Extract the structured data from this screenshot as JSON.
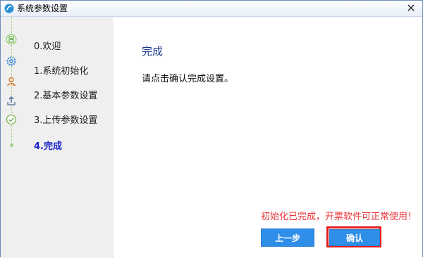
{
  "window": {
    "title": "系统参数设置",
    "close_glyph": "✕"
  },
  "steps": [
    {
      "label": "0.欢迎",
      "icon": "document-icon"
    },
    {
      "label": "1.系统初始化",
      "icon": "gear-icon"
    },
    {
      "label": "2.基本参数设置",
      "icon": "user-icon"
    },
    {
      "label": "3.上传参数设置",
      "icon": "upload-icon"
    },
    {
      "label": "4.完成",
      "icon": "check-circle-icon"
    }
  ],
  "main": {
    "heading": "完成",
    "instruction": "请点击确认完成设置。",
    "status": "初始化已完成，开票软件可正常使用！"
  },
  "buttons": {
    "prev_label": "上一步",
    "ok_label": "确认"
  },
  "colors": {
    "accent": "#2f8ee8",
    "active_step": "#1b24c8",
    "status_text": "#e8353a",
    "highlight": "#e21b1b"
  }
}
